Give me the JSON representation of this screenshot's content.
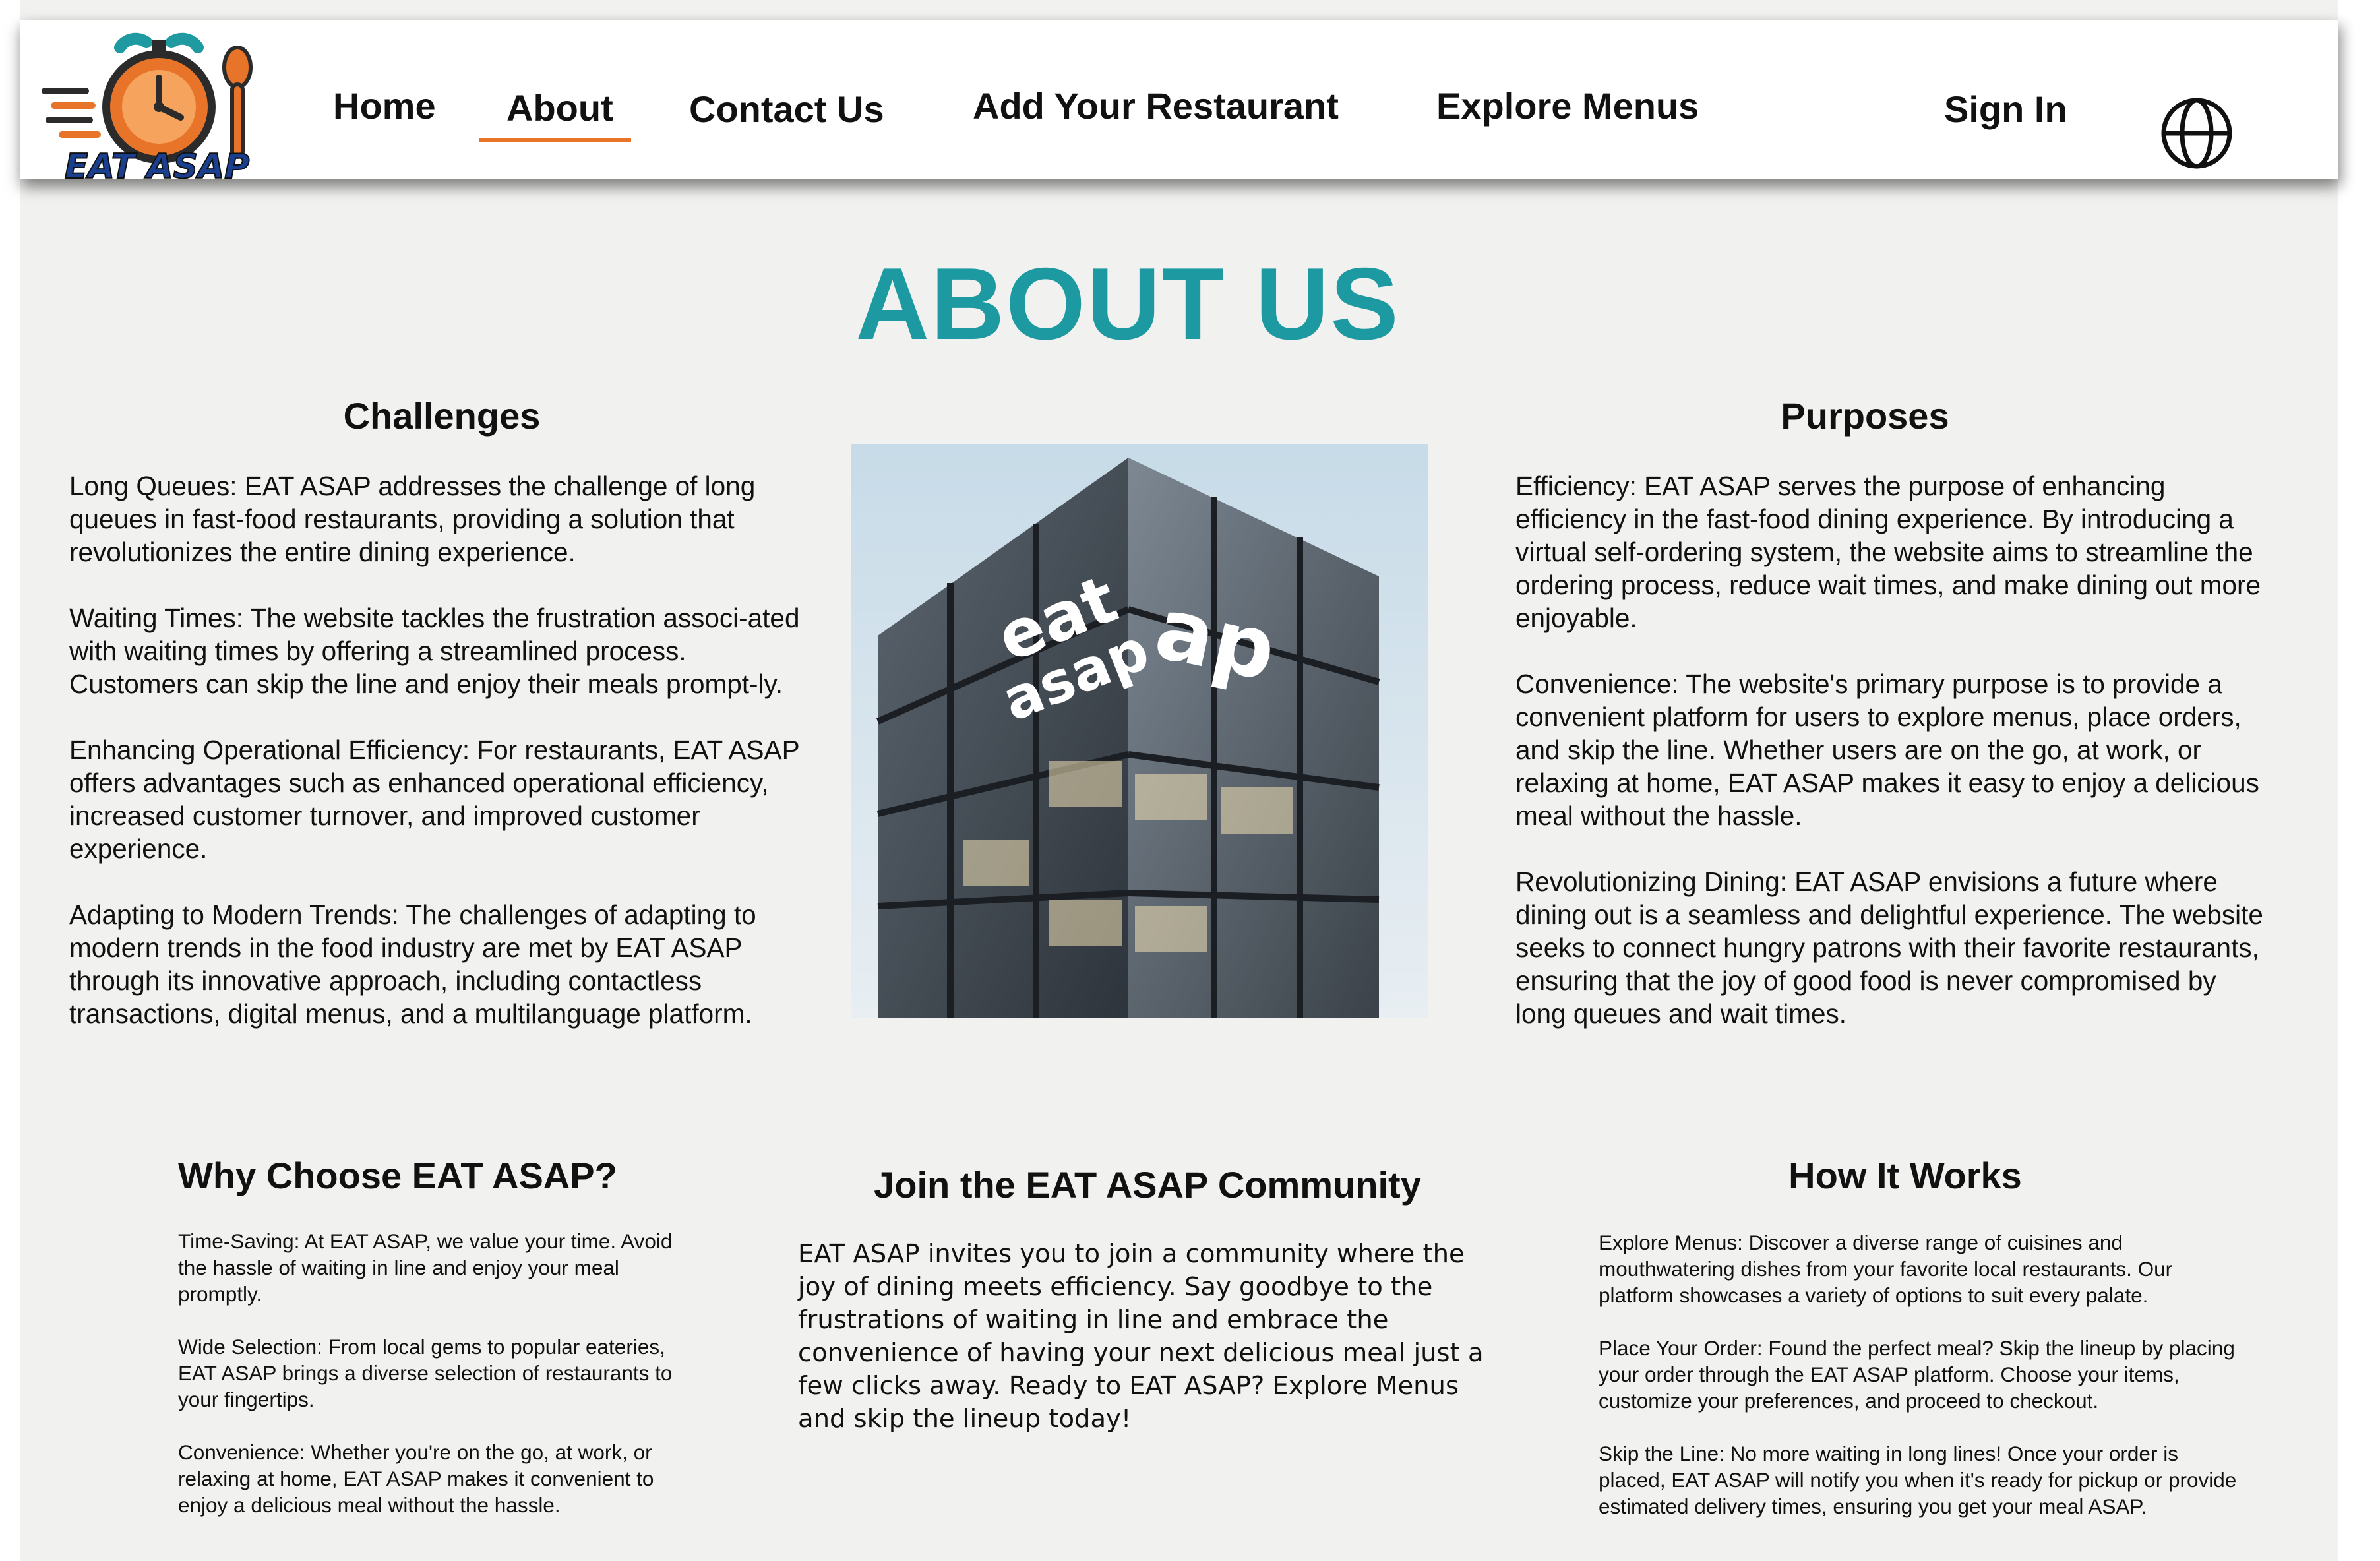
{
  "brand": {
    "logo_text": "EAT ASAP",
    "accent": "#e8742a",
    "teal": "#1d9aa1"
  },
  "nav": {
    "home": "Home",
    "about": "About",
    "contact": "Contact Us",
    "add_restaurant": "Add Your Restaurant",
    "explore": "Explore Menus",
    "sign_in": "Sign In",
    "active": "About",
    "language_icon": "globe-icon"
  },
  "page_title": "ABOUT US",
  "challenges": {
    "heading": "Challenges",
    "items": [
      "Long Queues: EAT ASAP addresses the challenge of long queues in fast-food restaurants, providing a solution that revolutionizes the entire dining experience.",
      "Waiting Times: The website tackles the frustration associ-ated with waiting times by offering a streamlined process. Customers can skip the line and enjoy their meals prompt-ly.",
      "Enhancing Operational Efficiency: For restaurants, EAT ASAP offers advantages such as enhanced operational efficiency, increased customer turnover, and improved customer experience.",
      "Adapting to Modern Trends: The challenges of adapting to modern trends in the food industry are met by EAT ASAP through its innovative approach, including contactless transactions, digital menus, and a multilanguage platform."
    ]
  },
  "purposes": {
    "heading": "Purposes",
    "items": [
      "Efficiency: EAT ASAP serves the purpose of enhancing efficiency in the fast-food dining experience. By introducing a virtual self-ordering system, the website aims to streamline the ordering process, reduce wait times, and make dining out more enjoyable.",
      "Convenience: The website's primary purpose is to provide a convenient platform for users to explore menus, place orders, and skip the line. Whether users are on the go, at work, or relaxing at home, EAT ASAP makes it easy to enjoy a delicious meal without the hassle.",
      "Revolutionizing Dining: EAT ASAP envisions a future where dining out is a seamless and delightful experience. The website seeks to connect hungry patrons with their favorite restaurants, ensuring that the joy of good food is never compromised by long queues and wait times."
    ]
  },
  "building_sign": {
    "line1": "eat",
    "line2": "asap",
    "mark": "ap"
  },
  "why": {
    "heading": "Why Choose EAT ASAP?",
    "items": [
      "Time-Saving: At EAT ASAP, we value your time. Avoid the hassle of waiting in line and enjoy your meal promptly.",
      "Wide Selection: From local gems to popular eateries, EAT ASAP brings a diverse selection of restaurants to your fingertips.",
      "Convenience: Whether you're on the go, at work, or relaxing at home, EAT ASAP makes it convenient to enjoy a delicious meal without the hassle."
    ]
  },
  "join": {
    "heading": "Join the EAT ASAP Community",
    "body": "EAT ASAP invites you to join a community where the joy of dining meets efficiency. Say goodbye to the frustrations of waiting in line and embrace the convenience of having your next delicious meal just a few clicks away. Ready to EAT ASAP? Explore Menus and skip the lineup today!"
  },
  "how": {
    "heading": "How It Works",
    "items": [
      "Explore Menus: Discover a diverse range of cuisines and mouthwatering dishes from your favorite local restaurants. Our platform showcases a variety of options to suit every palate.",
      "Place Your Order: Found the perfect meal? Skip the lineup by placing your order through the EAT ASAP platform. Choose your items, customize your preferences, and proceed to checkout.",
      "Skip the Line: No more waiting in long lines! Once your order is placed, EAT ASAP will notify you when it's ready for pickup or provide estimated delivery times, ensuring you get your meal ASAP."
    ]
  }
}
